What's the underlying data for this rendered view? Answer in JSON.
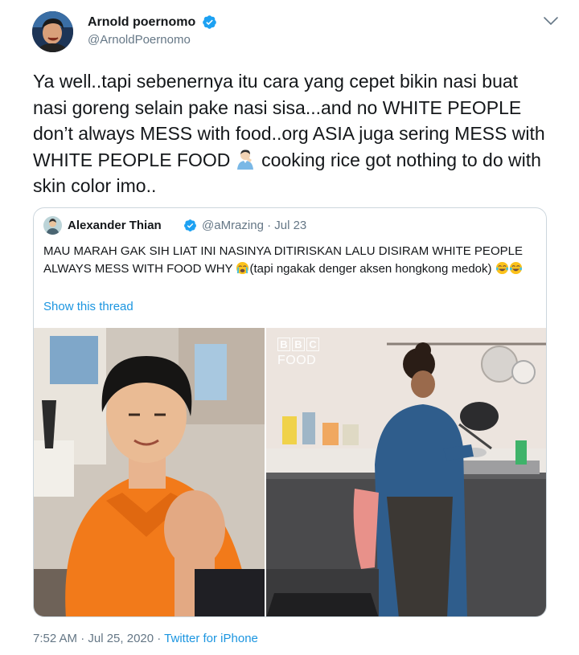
{
  "author": {
    "display_name": "Arnold poernomo",
    "handle": "@ArnoldPoernomo",
    "verified_icon": "verified-badge-icon",
    "more_icon": "chevron-down-icon"
  },
  "tweet": {
    "text_part1": "Ya well..tapi sebenernya itu cara yang cepet bikin nasi buat nasi goreng selain pake nasi sisa...and no WHITE PEOPLE don’t always MESS with food..org ASIA juga sering MESS with WHITE PEOPLE FOOD ",
    "emoji": "facepalm-man-emoji",
    "text_part2": " cooking rice got nothing to do with skin color imo.."
  },
  "quoted_tweet": {
    "display_name": "Alexander Thian",
    "handle_date": "@aMrazing · Jul 23",
    "text_part1": "MAU MARAH GAK SIH LIAT INI NASINYA DITIRISKAN LALU DISIRAM WHITE PEOPLE ALWAYS MESS WITH FOOD WHY ",
    "text_part2": "(tapi ngakak denger aksen hongkong medok) ",
    "show_thread": "Show this thread",
    "media": {
      "left_image": "man-in-orange-shirt-photo",
      "right_image": "woman-cooking-at-sink-photo",
      "watermark_letters": [
        "B",
        "B",
        "C"
      ],
      "watermark_word": "FOOD"
    }
  },
  "footer": {
    "time_date": "7:52 AM · Jul 25, 2020 · ",
    "source": "Twitter for iPhone"
  },
  "colors": {
    "link": "#1b95e0",
    "secondary_text": "#657786",
    "primary_text": "#14171a",
    "border": "#ccd6dd"
  }
}
